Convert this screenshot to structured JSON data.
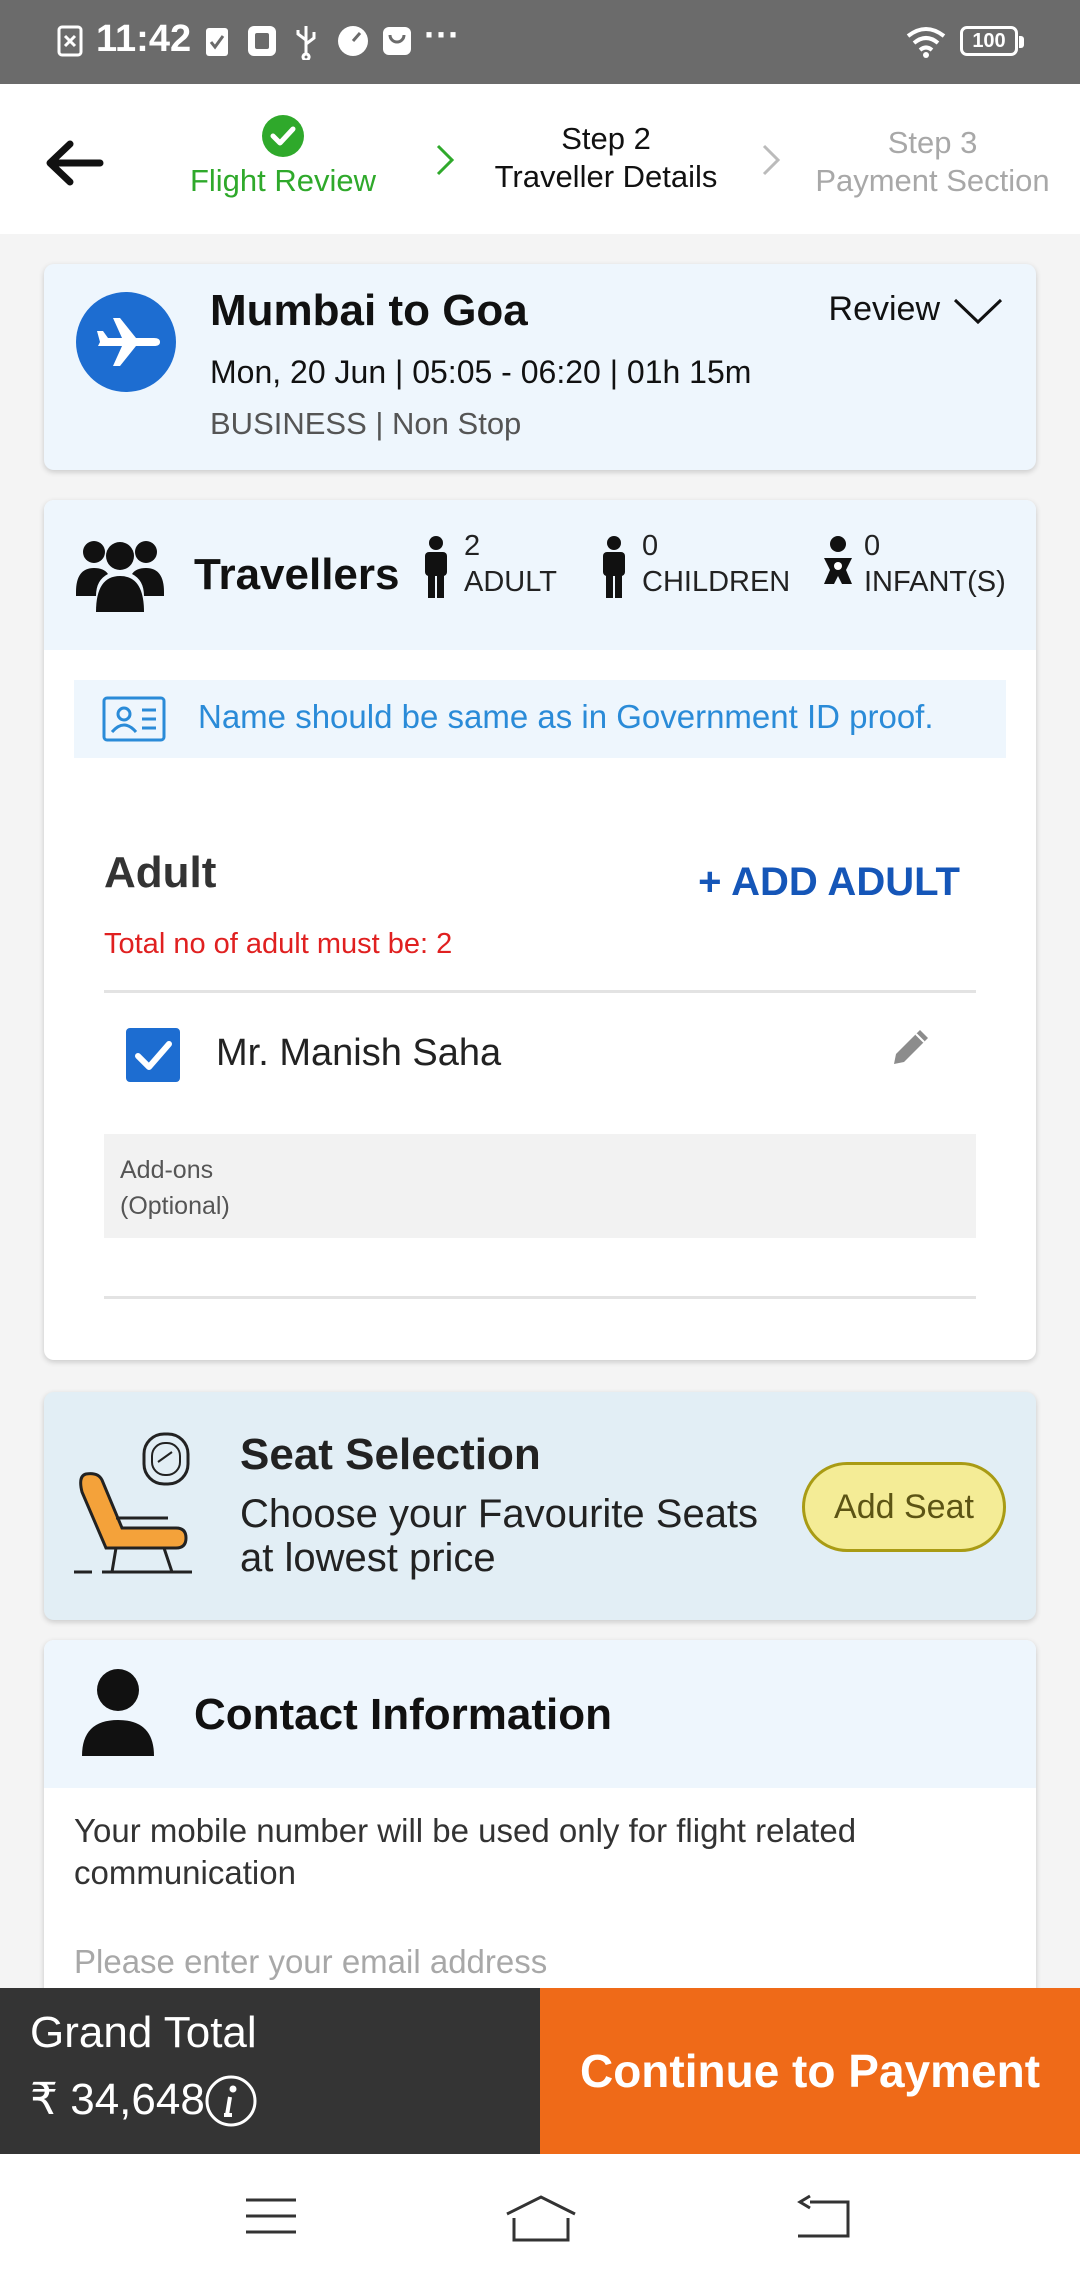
{
  "status_bar": {
    "time": "11:42",
    "battery": "100",
    "more": "···"
  },
  "stepper": {
    "step1_label": "Flight Review",
    "step2_number": "Step 2",
    "step2_label": "Traveller Details",
    "step3_number": "Step 3",
    "step3_label": "Payment Section",
    "done_color": "#2fa92b"
  },
  "flight": {
    "route": "Mumbai to Goa",
    "schedule": "Mon, 20 Jun | 05:05 - 06:20 | 01h 15m",
    "cabin": "BUSINESS | Non Stop",
    "review_label": "Review"
  },
  "travellers": {
    "title": "Travellers",
    "adult_count": "2",
    "adult_label": "ADULT",
    "children_count": "0",
    "children_label": "CHILDREN",
    "infant_count": "0",
    "infant_label": "INFANT(S)",
    "id_note": "Name should be same as in Government ID proof.",
    "section_label": "Adult",
    "add_adult": "+ ADD ADULT",
    "warning": "Total no of adult must be: 2",
    "list": [
      {
        "name": "Mr. Manish Saha",
        "checked": true
      }
    ],
    "addons_title": "Add-ons",
    "addons_note": "(Optional)"
  },
  "seat": {
    "title": "Seat Selection",
    "subtitle": "Choose your Favourite Seats at lowest price",
    "button": "Add Seat"
  },
  "contact": {
    "title": "Contact Information",
    "note": "Your mobile number will be used only for flight related communication",
    "email_placeholder": "Please enter your email address"
  },
  "footer": {
    "total_label": "Grand Total",
    "total_amount": "₹ 34,648",
    "continue_label": "Continue to Payment",
    "accent": "#ef6a18"
  }
}
